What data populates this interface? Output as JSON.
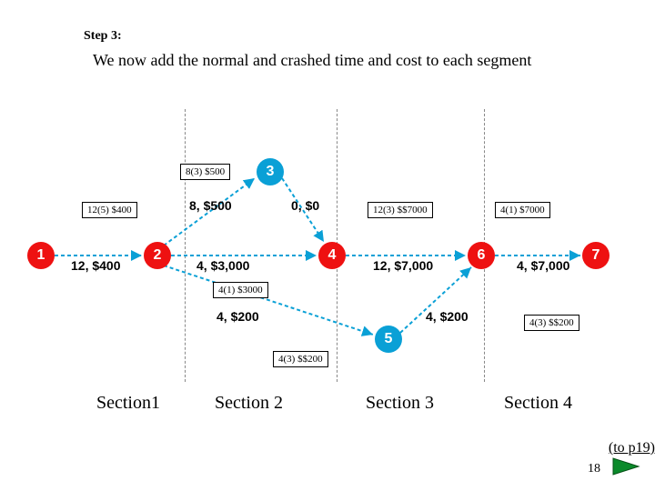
{
  "step_label": "Step 3:",
  "description": "We now add the normal and crashed time and cost to each segment",
  "nodes": {
    "n1": "1",
    "n2": "2",
    "n3": "3",
    "n4": "4",
    "n5": "5",
    "n6": "6",
    "n7": "7"
  },
  "edge_labels": {
    "e12": "12, $400",
    "e23": "8, $500",
    "e34": "0, $0",
    "e24": "4, $3,000",
    "e25": "4, $200",
    "e46": "12, $7,000",
    "e56": "4, $200",
    "e67": "4, $7,000"
  },
  "boxes": {
    "b1": "8(3) $500",
    "b2": "12(5) $400",
    "b3": "12(3) $$7000",
    "b4": "4(1) $7000",
    "b5": "4(1) $3000",
    "b6": "4(3) $$200",
    "b7": "4(3) $$200"
  },
  "sections": {
    "s1": "Section1",
    "s2": "Section 2",
    "s3": "Section 3",
    "s4": "Section 4"
  },
  "nav_link": "(to p19)",
  "page_number": "18",
  "chart_data": {
    "type": "diagram",
    "title": "Network with normal/crashed time and cost annotations",
    "nodes": [
      {
        "id": 1,
        "section": 1,
        "color": "red"
      },
      {
        "id": 2,
        "section": 2,
        "color": "red"
      },
      {
        "id": 3,
        "section": 2,
        "color": "blue"
      },
      {
        "id": 4,
        "section": 3,
        "color": "red"
      },
      {
        "id": 5,
        "section": 3,
        "color": "blue"
      },
      {
        "id": 6,
        "section": 4,
        "color": "red"
      },
      {
        "id": 7,
        "section": 4,
        "color": "red"
      }
    ],
    "edges": [
      {
        "from": 1,
        "to": 2,
        "normal_time": 12,
        "normal_cost": 400,
        "crashed_time": 5,
        "crashed_cost": 400
      },
      {
        "from": 2,
        "to": 3,
        "normal_time": 8,
        "normal_cost": 500,
        "crashed_time": 3,
        "crashed_cost": 500
      },
      {
        "from": 3,
        "to": 4,
        "normal_time": 0,
        "normal_cost": 0
      },
      {
        "from": 2,
        "to": 4,
        "normal_time": 4,
        "normal_cost": 3000,
        "crashed_time": 1,
        "crashed_cost": 3000
      },
      {
        "from": 2,
        "to": 5,
        "normal_time": 4,
        "normal_cost": 200,
        "crashed_time": 3,
        "crashed_cost": 200
      },
      {
        "from": 4,
        "to": 6,
        "normal_time": 12,
        "normal_cost": 7000,
        "crashed_time": 3,
        "crashed_cost": 7000
      },
      {
        "from": 5,
        "to": 6,
        "normal_time": 4,
        "normal_cost": 200,
        "crashed_time": 3,
        "crashed_cost": 200
      },
      {
        "from": 6,
        "to": 7,
        "normal_time": 4,
        "normal_cost": 7000,
        "crashed_time": 1,
        "crashed_cost": 7000
      }
    ],
    "section_dividers": [
      1,
      2,
      3,
      4
    ]
  }
}
